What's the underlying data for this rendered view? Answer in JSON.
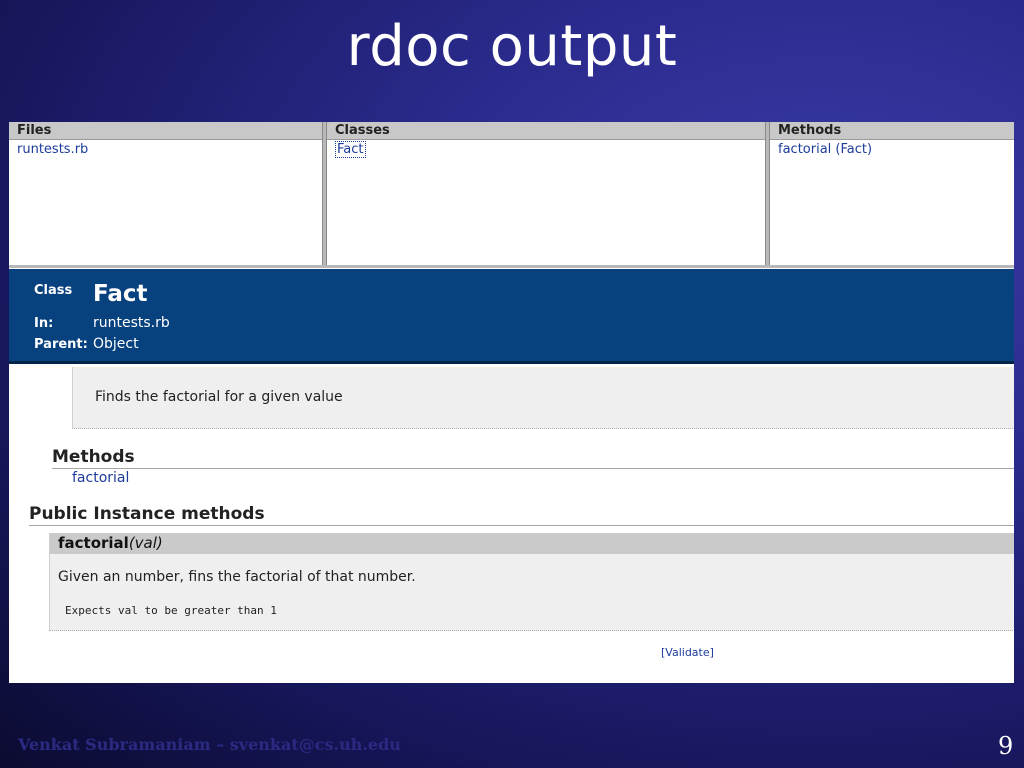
{
  "slide": {
    "title": "rdoc output",
    "footer": "Venkat Subramaniam – svenkat@cs.uh.edu",
    "page_number": "9"
  },
  "frames": {
    "files": {
      "header": "Files",
      "items": [
        "runtests.rb"
      ]
    },
    "classes": {
      "header": "Classes",
      "items": [
        "Fact"
      ]
    },
    "methods": {
      "header": "Methods",
      "items": [
        "factorial (Fact)"
      ]
    }
  },
  "class_header": {
    "kind_label": "Class",
    "name": "Fact",
    "in_label": "In:",
    "in_value": "runtests.rb",
    "parent_label": "Parent:",
    "parent_value": "Object"
  },
  "description": "Finds the factorial for a given value",
  "methods_section": {
    "heading": "Methods",
    "items": [
      "factorial"
    ]
  },
  "public_instance": {
    "heading": "Public Instance methods",
    "method_name": "factorial",
    "method_args": "(val)",
    "method_description": "Given an number, fins the factorial of that number.",
    "method_code": "Expects val to be greater than 1"
  },
  "validate_link": "[Validate]"
}
